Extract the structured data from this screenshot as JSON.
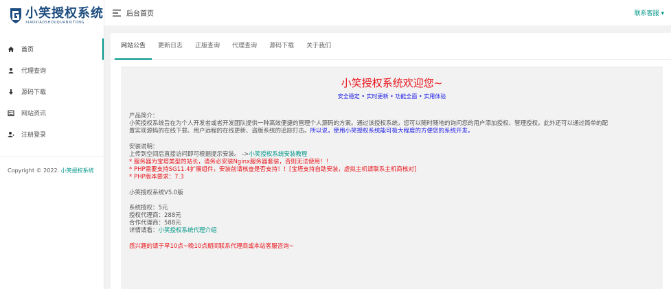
{
  "colors": {
    "accent": "#009688",
    "red": "#e8141b",
    "blue": "#1a1ae6",
    "brand": "#1e4d80"
  },
  "brand": {
    "title": "小笑授权系统",
    "subtitle": "XIAOXIAOSHOUQUANXITONG"
  },
  "sidebar": {
    "items": [
      {
        "label": "首页",
        "icon": "home-icon"
      },
      {
        "label": "代理查询",
        "icon": "user-icon"
      },
      {
        "label": "源码下载",
        "icon": "download-icon"
      },
      {
        "label": "网站资讯",
        "icon": "news-icon"
      },
      {
        "label": "注册登录",
        "icon": "user-add-icon"
      }
    ],
    "copyright": {
      "prefix": "Copyright © 2022. ",
      "link": "小笑授权系统"
    }
  },
  "header": {
    "title": "后台首页",
    "contact": "联系客服 ▾"
  },
  "tabs": [
    {
      "label": "网站公告"
    },
    {
      "label": "更新日志"
    },
    {
      "label": "正版查询"
    },
    {
      "label": "代理查询"
    },
    {
      "label": "源码下载"
    },
    {
      "label": "关于我们"
    }
  ],
  "notice": {
    "welcome": "小笑授权系统欢迎您~",
    "slogan": "安全稳定 • 实时更新 • 功能全面 • 实用体验",
    "intro_title": "产品简介：",
    "intro_line1": "小笑授权系统旨在为个人开发者或者开发团队提供一种高效便捷的管理个人源码的方案。通过该授权系统，您可以随时随地的询问您的用户添加授权、管理授权。此外还可以通过简单的配",
    "intro_line2_a": "置实现源码的在线下载、用户远程的在线更新、盗版系统的追踪打击。",
    "intro_line2_b": "所以说，使用小笑授权系统能可极大程度的方便您的系统开发。",
    "install_title": "安装说明：",
    "install_line1_a": "上传到空间后直接访问即可根据提示安装。  ->",
    "install_line1_link": "小笑授权系统安装教程",
    "install_line2": "* 服务器为宝塔类型的站长，请务必安装Nginx服务器套装，否则无法使用！！",
    "install_line3": "* PHP需要支持SG11.4扩展组件，安装前请核查是否支持！！[宝塔支持自助安装，虚拟主机请联系主机商核对]",
    "install_line4": "* PHP版本要求：7.3",
    "version": "小笑授权系统V5.0版",
    "price1": "系统授权：5元",
    "price2": "授权代理商：288元",
    "price3": "合作代理商：588元",
    "detail_label": "详情请看：",
    "detail_link": "小笑授权系统代理介绍",
    "footer": "感兴趣的请于早10点~晚10点期间联系代理商或本站客服咨询~"
  }
}
